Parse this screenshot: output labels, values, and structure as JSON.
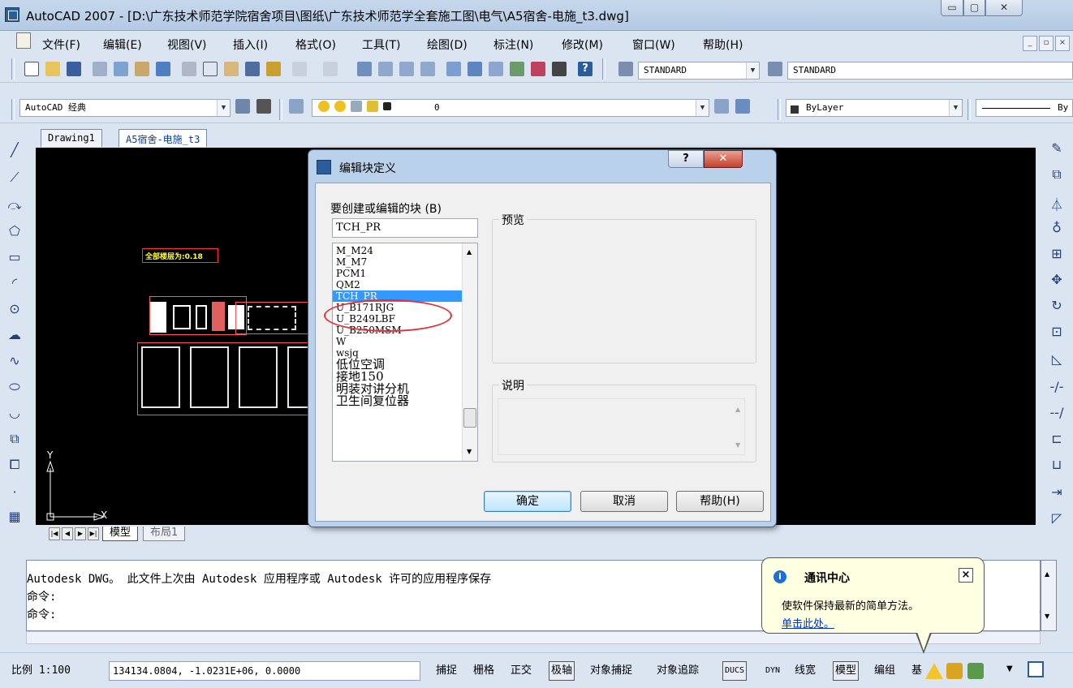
{
  "window": {
    "title": "AutoCAD 2007 - [D:\\广东技术师范学院宿舍项目\\图纸\\广东技术师范学全套施工图\\电气\\A5宿舍-电施_t3.dwg]",
    "min": "▭",
    "max": "▢",
    "close": "✕"
  },
  "menu": {
    "items": [
      "文件(F)",
      "编辑(E)",
      "视图(V)",
      "插入(I)",
      "格式(O)",
      "工具(T)",
      "绘图(D)",
      "标注(N)",
      "修改(M)",
      "窗口(W)",
      "帮助(H)"
    ]
  },
  "toolbar1": {
    "text_style": "STANDARD",
    "dim_style": "STANDARD"
  },
  "toolbar2": {
    "workspace": "AutoCAD 经典",
    "layer": "0",
    "color": "ByLayer",
    "linetype_tail": "By"
  },
  "tabs": {
    "doc1": "Drawing1",
    "doc2": "A5宿舍-电施_t3"
  },
  "drawing": {
    "scale_label": "全部楼层为:0.18",
    "ucs_y": "Y",
    "ucs_x": "X"
  },
  "layout_tabs": {
    "model": "模型",
    "layout1": "布局1"
  },
  "command": {
    "line1": "Autodesk DWG。  此文件上次由 Autodesk 应用程序或 Autodesk 许可的应用程序保存",
    "line2": "命令:",
    "line3": "命令:"
  },
  "status": {
    "scale": "比例 1:100",
    "coords": "134134.0804,  -1.0231E+06, 0.0000",
    "buttons": [
      "捕捉",
      "栅格",
      "正交",
      "极轴",
      "对象捕捉",
      "对象追踪",
      "DUCS",
      "DYN",
      "线宽",
      "模型",
      "编组",
      "基"
    ]
  },
  "dialog": {
    "title": "编辑块定义",
    "help_btn": "?",
    "close_btn": "✕",
    "label_block": "要创建或编辑的块 (B)",
    "block_name": "TCH_PR",
    "list": [
      "M_M24",
      "M_M7",
      "PCM1",
      "QM2",
      "TCH_PR",
      "U_B171RJG",
      "U_B249LBF",
      "U_B250MSM",
      "W",
      "wsjq",
      "低位空调",
      "接地150",
      "明装对讲分机",
      "卫生间复位器"
    ],
    "selected": "TCH_PR",
    "preview_label": "预览",
    "desc_label": "说明",
    "ok": "确定",
    "cancel": "取消",
    "help": "帮助(H)"
  },
  "balloon": {
    "title": "通讯中心",
    "text": "使软件保持最新的简单方法。",
    "link": "单击此处。"
  }
}
